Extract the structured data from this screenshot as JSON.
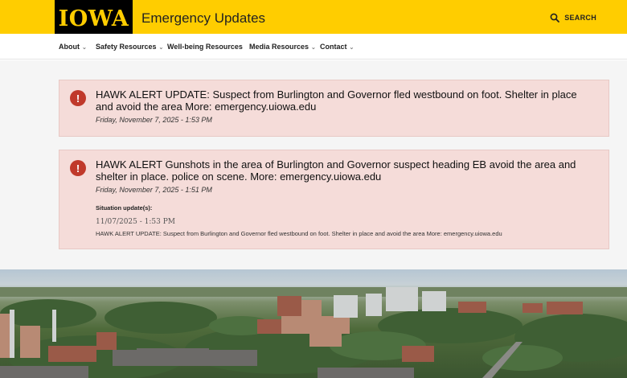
{
  "header": {
    "logo_text": "IOWA",
    "site_title": "Emergency Updates",
    "search_label": "SEARCH",
    "colors": {
      "brand_gold": "#ffcd00",
      "brand_black": "#000000"
    }
  },
  "nav": {
    "items": [
      {
        "label": "About",
        "has_dropdown": true
      },
      {
        "label": "Safety Resources",
        "has_dropdown": true
      },
      {
        "label": "Well-being Resources",
        "has_dropdown": false
      },
      {
        "label": "Media Resources",
        "has_dropdown": true
      },
      {
        "label": "Contact",
        "has_dropdown": true
      }
    ]
  },
  "alerts": [
    {
      "icon": "!",
      "title": "HAWK ALERT UPDATE: Suspect from Burlington and Governor fled westbound on foot. Shelter in place and avoid the area More: emergency.uiowa.edu",
      "date": "Friday, November 7, 2025 - 1:53 PM"
    },
    {
      "icon": "!",
      "title": "HAWK ALERT Gunshots in the area of Burlington and Governor suspect heading EB avoid the area and shelter in place. police on scene. More: emergency.uiowa.edu",
      "date": "Friday, November 7, 2025 - 1:51 PM",
      "situation_label": "Situation update(s):",
      "situation_date": "11/07/2025 - 1:53 PM",
      "situation_text": "HAWK ALERT UPDATE: Suspect from Burlington and Governor fled westbound on foot. Shelter in place and avoid the area More: emergency.uiowa.edu"
    }
  ],
  "colors": {
    "alert_background": "#f5dcd9",
    "alert_icon": "#c0392b"
  }
}
